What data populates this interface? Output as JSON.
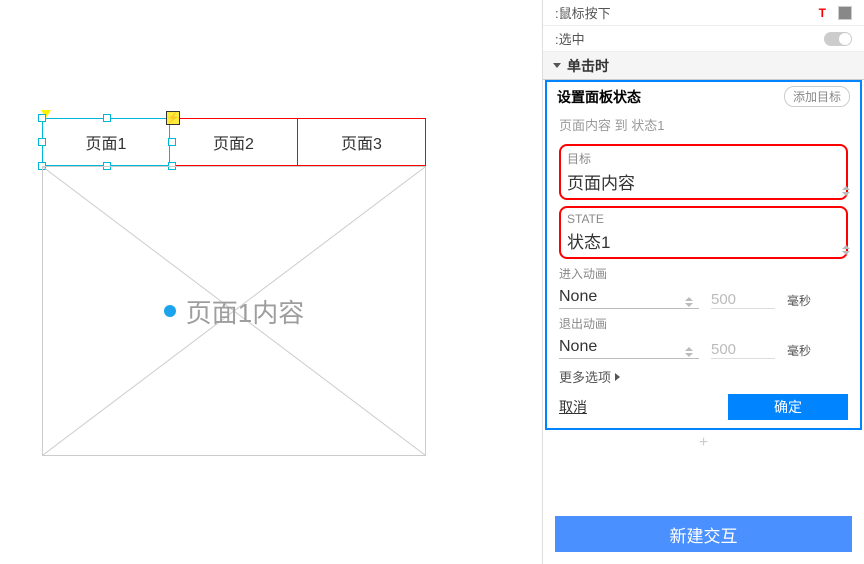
{
  "canvas": {
    "tabs": [
      "页面1",
      "页面2",
      "页面3"
    ],
    "selected_tab_index": 0,
    "placeholder_text": "页面1内容",
    "bolt_icon": "lightning"
  },
  "panel": {
    "prop_rows": [
      {
        "label": ":鼠标按下",
        "kind": "color"
      },
      {
        "label": ":选中",
        "kind": "toggle"
      }
    ],
    "event_section": "单击时",
    "action_title": "设置面板状态",
    "add_target": "添加目标",
    "action_subtitle": "页面内容 到 状态1",
    "target_label": "目标",
    "target_value": "页面内容",
    "state_label": "STATE",
    "state_value": "状态1",
    "enter_anim_label": "进入动画",
    "enter_anim_value": "None",
    "enter_anim_dur": "500",
    "exit_anim_label": "退出动画",
    "exit_anim_value": "None",
    "exit_anim_dur": "500",
    "duration_unit": "毫秒",
    "more_options": "更多选项",
    "cancel": "取消",
    "ok": "确定",
    "plus": "+",
    "new_interaction": "新建交互"
  }
}
